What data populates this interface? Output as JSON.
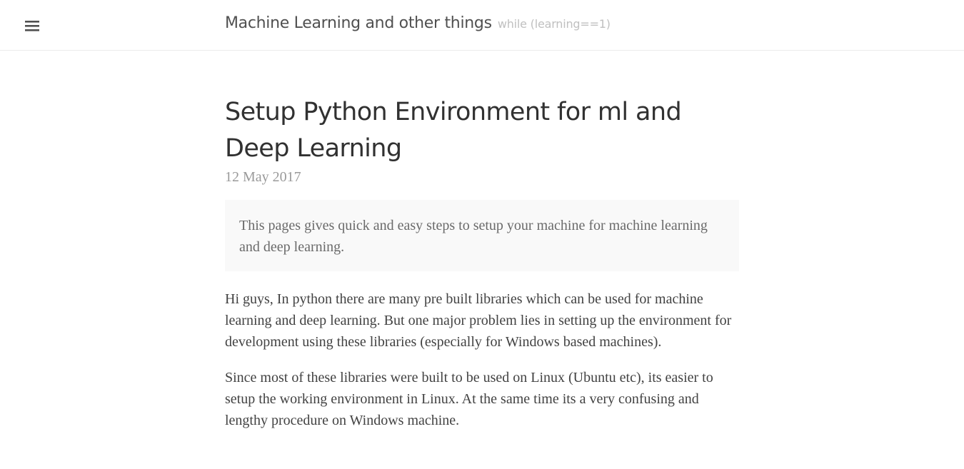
{
  "header": {
    "menu_icon": "hamburger-menu-icon",
    "site_title": "Machine Learning and other things",
    "site_tagline": "while (learning==1)"
  },
  "post": {
    "title": "Setup Python Environment for ml and Deep Learning",
    "date": "12 May 2017",
    "lead": "This pages gives quick and easy steps to setup your machine for machine learning and deep learning.",
    "paragraphs": [
      "Hi guys, In python there are many pre built libraries which can be used for machine learning and deep learning. But one major problem lies in setting up the environment for development using these libraries (especially for Windows based machines).",
      "Since most of these libraries were built to be used on Linux (Ubuntu etc), its easier to setup the working environment in Linux. At the same time its a very confusing and lengthy procedure on Windows machine."
    ]
  },
  "colors": {
    "title_text": "#505050",
    "tagline_text": "#c0c0c0",
    "date_text": "#9a9a9a",
    "lead_background": "#f9f9f9"
  }
}
